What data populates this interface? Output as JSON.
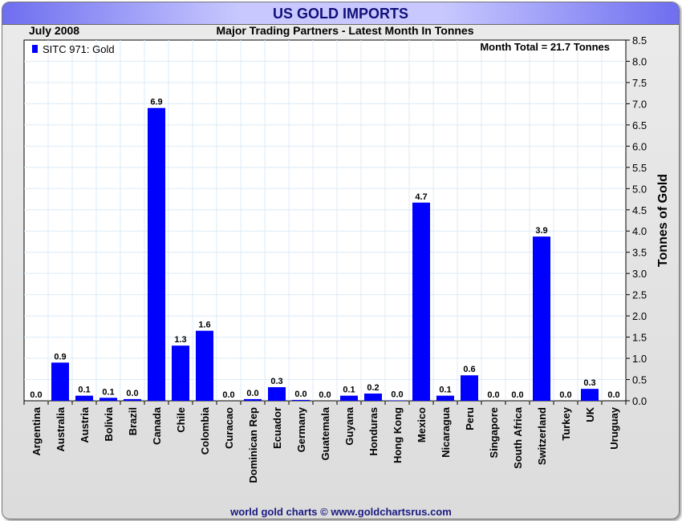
{
  "header": {
    "title": "US GOLD IMPORTS",
    "date": "July 2008",
    "subtitle": "Major Trading Partners - Latest Month In Tonnes"
  },
  "footer": "world gold charts © www.goldchartsrus.com",
  "chart_data": {
    "type": "bar",
    "title": "Major Trading Partners - Latest Month In Tonnes",
    "ylabel": "Tonnes of Gold",
    "xlabel": "",
    "ylim": [
      0,
      8.5
    ],
    "ytick_step": 0.5,
    "grid": true,
    "legend": {
      "label": "SITC 971: Gold",
      "placement": "top-left"
    },
    "annotation": "Month Total = 21.7 Tonnes",
    "bar_color": "#0000ff",
    "categories": [
      "Argentina",
      "Australia",
      "Austria",
      "Bolivia",
      "Brazil",
      "Canada",
      "Chile",
      "Colombia",
      "Curacao",
      "Dominican Rep",
      "Ecuador",
      "Germany",
      "Guatemala",
      "Guyana",
      "Honduras",
      "Hong Kong",
      "Mexico",
      "Nicaragua",
      "Peru",
      "Singapore",
      "South Africa",
      "Switzerland",
      "Turkey",
      "UK",
      "Uruguay"
    ],
    "values": [
      0.0,
      0.9,
      0.12,
      0.07,
      0.04,
      6.9,
      1.3,
      1.65,
      0.0,
      0.04,
      0.32,
      0.02,
      0.0,
      0.12,
      0.17,
      0.01,
      4.67,
      0.12,
      0.6,
      0.0,
      0.0,
      3.87,
      0.0,
      0.28,
      0.0
    ],
    "labels": [
      "0.0",
      "0.9",
      "0.1",
      "0.1",
      "0.0",
      "6.9",
      "1.3",
      "1.6",
      "0.0",
      "0.0",
      "0.3",
      "0.0",
      "0.0",
      "0.1",
      "0.2",
      "0.0",
      "4.7",
      "0.1",
      "0.6",
      "0.0",
      "0.0",
      "3.9",
      "0.0",
      "0.3",
      "0.0"
    ]
  }
}
